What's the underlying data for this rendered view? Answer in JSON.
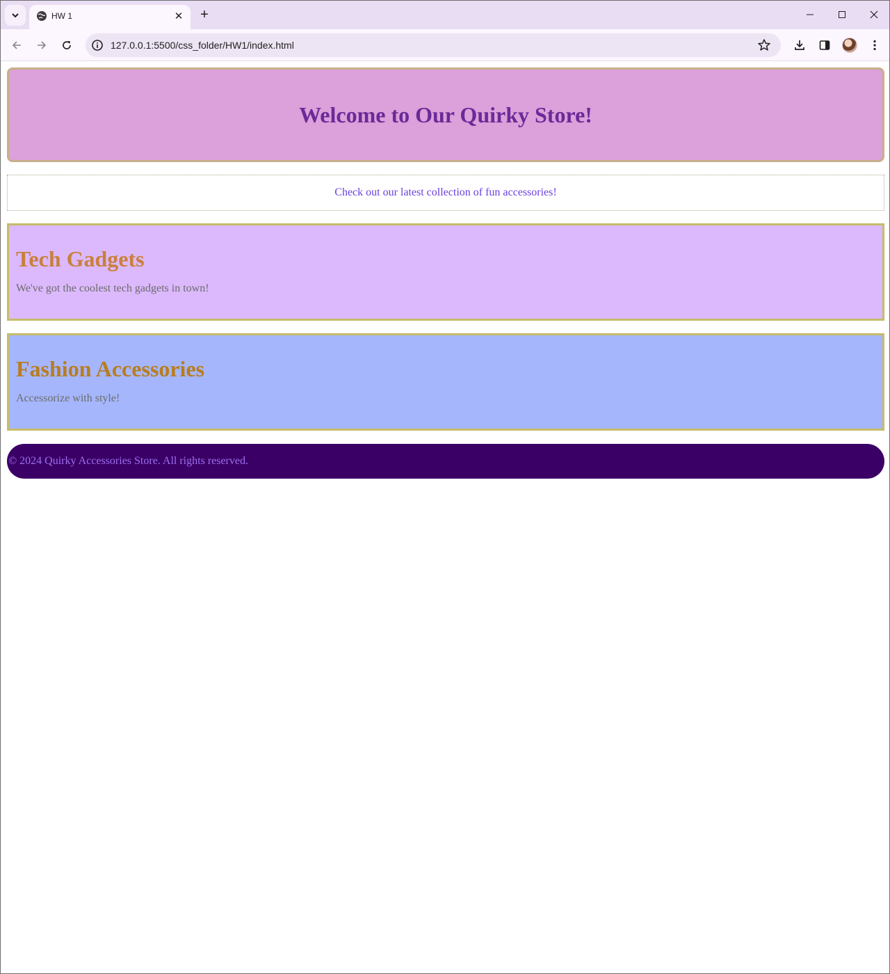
{
  "browser": {
    "tab": {
      "title": "HW 1"
    },
    "address_bar": {
      "url": "127.0.0.1:5500/css_folder/HW1/index.html"
    }
  },
  "page": {
    "header": {
      "title": "Welcome to Our Quirky Store!"
    },
    "promo": {
      "text": "Check out our latest collection of fun accessories!"
    },
    "sections": [
      {
        "heading": "Tech Gadgets",
        "text": "We've got the coolest tech gadgets in town!"
      },
      {
        "heading": "Fashion Accessories",
        "text": "Accessorize with style!"
      }
    ],
    "footer": {
      "text": "© 2024 Quirky Accessories Store. All rights reserved."
    }
  },
  "colors": {
    "tabstrip_bg": "#e9ddf4",
    "header_bg": "#dca0da",
    "header_text": "#6a2a98",
    "promo_text": "#6a3fe0",
    "tech_bg": "#dcb9fd",
    "fashion_bg": "#a5b6fc",
    "section_heading": "#c9803c",
    "footer_bg": "#3b0066",
    "footer_text": "#9b6ff0"
  }
}
